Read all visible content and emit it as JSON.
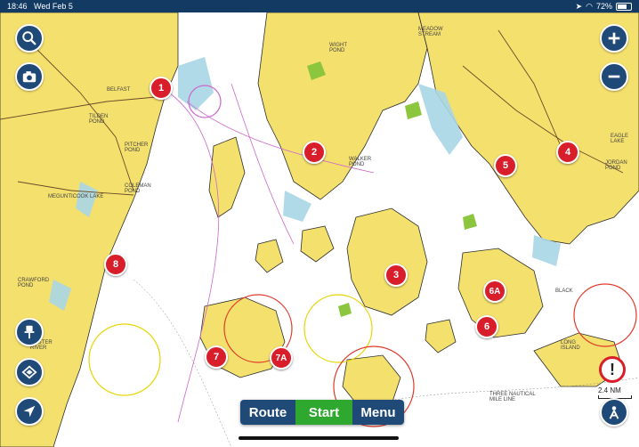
{
  "status": {
    "time": "18:46",
    "date": "Wed Feb 5",
    "battery": "72%",
    "battery_level": 0.72
  },
  "icons": {
    "search": "search-icon",
    "camera": "camera-icon",
    "zoom_in": "plus-icon",
    "zoom_out": "minus-icon",
    "pin": "pushpin-icon",
    "layers": "layers-icon",
    "locate": "location-arrow-icon",
    "alert": "exclamation-icon",
    "profile": "compass-person-icon"
  },
  "markers": [
    {
      "id": "1",
      "label": "1"
    },
    {
      "id": "2",
      "label": "2"
    },
    {
      "id": "3",
      "label": "3"
    },
    {
      "id": "4",
      "label": "4"
    },
    {
      "id": "5",
      "label": "5"
    },
    {
      "id": "6",
      "label": "6"
    },
    {
      "id": "6A",
      "label": "6A"
    },
    {
      "id": "7",
      "label": "7"
    },
    {
      "id": "7A",
      "label": "7A"
    },
    {
      "id": "8",
      "label": "8"
    }
  ],
  "places": [
    "BELFAST",
    "TILDEN POND",
    "PITCHER POND",
    "COLEMAN POND",
    "MEGUNTICOOK LAKE",
    "CRAWFORD POND",
    "OYSTER RIVER",
    "WIGHT POND",
    "MEADOW STREAM",
    "WALKER POND",
    "EAGLE LAKE",
    "JORDAN POND",
    "BLACK",
    "LONG ISLAND",
    "THREE NAUTICAL MILE LINE"
  ],
  "toolbar": {
    "route": "Route",
    "start": "Start",
    "menu": "Menu"
  },
  "scale": {
    "label": "2.4 NM"
  },
  "colors": {
    "land": "#f4e06d",
    "water": "#ffffff",
    "shallow": "#a9d6e6",
    "bar": "#1f4a78",
    "start": "#2ea82e",
    "marker": "#d81e2a"
  }
}
